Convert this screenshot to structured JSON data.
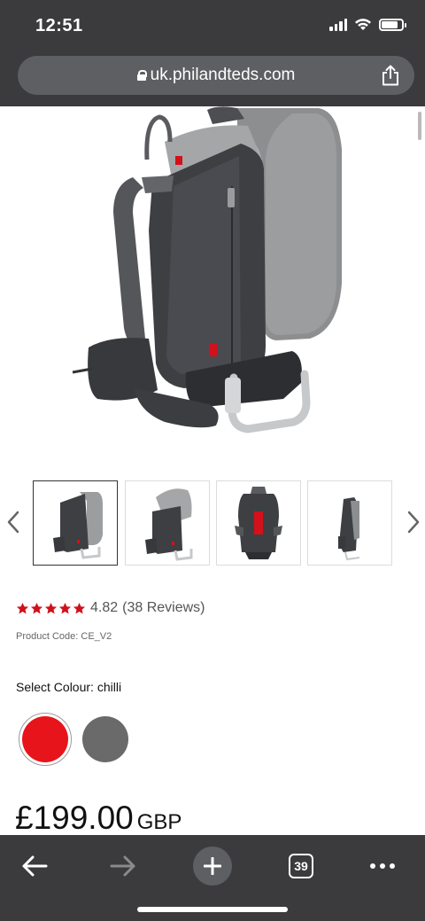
{
  "status_bar": {
    "time": "12:51"
  },
  "browser": {
    "url": "uk.philandteds.com",
    "tab_count": "39"
  },
  "icons": {
    "lock": "lock-icon",
    "share": "share-icon",
    "back": "arrow-left-icon",
    "forward": "arrow-right-icon",
    "new_tab": "plus-icon",
    "tabs": "tabs-icon",
    "more": "more-icon",
    "thumb_prev": "chevron-left-icon",
    "thumb_next": "chevron-right-icon",
    "star": "star-icon"
  },
  "product": {
    "rating_value": "4.82",
    "reviews": "(38 Reviews)",
    "stars": 5,
    "product_code": "Product Code: CE_V2",
    "select_colour_label": "Select Colour: chilli",
    "colours": [
      {
        "name": "chilli",
        "hex": "#e8141b",
        "selected": true
      },
      {
        "name": "grey",
        "hex": "#6a6a6b",
        "selected": false
      }
    ],
    "price": "£199.00",
    "currency": "GBP"
  },
  "colors": {
    "chrome": "#3b3b3d",
    "url_bar": "#5e5f62",
    "star": "#d0111b"
  }
}
